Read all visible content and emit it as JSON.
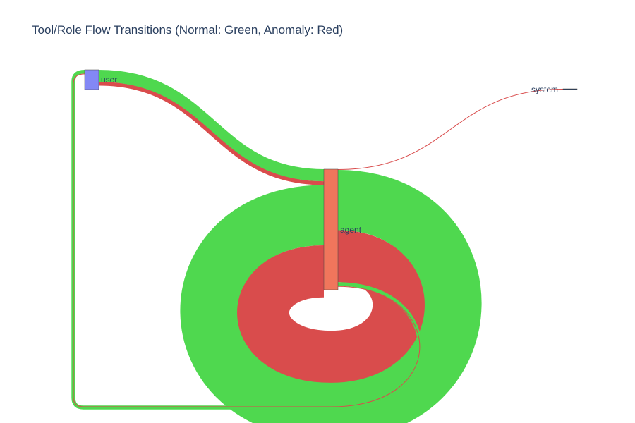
{
  "chart_data": {
    "type": "sankey",
    "title": "Tool/Role Flow Transitions (Normal: Green, Anomaly: Red)",
    "nodes": [
      {
        "id": "user",
        "label": "user",
        "color": "#8388f5"
      },
      {
        "id": "agent",
        "label": "agent",
        "color": "#f0765c"
      },
      {
        "id": "system",
        "label": "system",
        "color": "#2a3f5f"
      }
    ],
    "links": [
      {
        "source": "user",
        "target": "agent",
        "value": 19,
        "status": "normal"
      },
      {
        "source": "user",
        "target": "agent",
        "value": 6,
        "status": "anomaly"
      },
      {
        "source": "agent",
        "target": "agent",
        "value": 95,
        "status": "normal"
      },
      {
        "source": "agent",
        "target": "agent",
        "value": 82,
        "status": "anomaly"
      },
      {
        "source": "agent",
        "target": "user",
        "value": 6,
        "status": "normal"
      },
      {
        "source": "agent",
        "target": "user",
        "value": 1,
        "status": "anomaly"
      },
      {
        "source": "agent",
        "target": "system",
        "value": 0.3,
        "status": "anomaly"
      }
    ],
    "colors": {
      "normal": "#4fd84f",
      "anomaly": "#d94c4c"
    }
  }
}
